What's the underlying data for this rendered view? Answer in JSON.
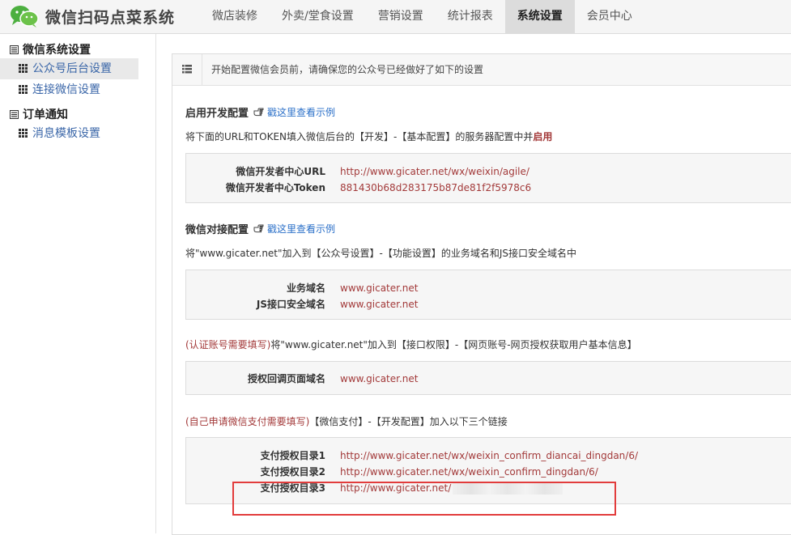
{
  "app": {
    "title": "微信扫码点菜系统"
  },
  "nav": [
    {
      "label": "微店装修"
    },
    {
      "label": "外卖/堂食设置"
    },
    {
      "label": "营销设置"
    },
    {
      "label": "统计报表"
    },
    {
      "label": "系统设置",
      "active": true
    },
    {
      "label": "会员中心"
    }
  ],
  "sidebar": {
    "groups": [
      {
        "title": "微信系统设置",
        "items": [
          {
            "label": "公众号后台设置",
            "active": true
          },
          {
            "label": "连接微信设置"
          }
        ]
      },
      {
        "title": "订单通知",
        "items": [
          {
            "label": "消息模板设置"
          }
        ]
      }
    ]
  },
  "content": {
    "header": "开始配置微信会员前，请确保您的公众号已经做好了如下的设置",
    "sections": [
      {
        "title": "启用开发配置",
        "link": "戳这里查看示例",
        "desc_pre": "将下面的URL和TOKEN填入微信后台的【开发】-【基本配置】的服务器配置中并",
        "desc_red": "启用",
        "rows": [
          {
            "label": "微信开发者中心URL",
            "value": "http://www.gicater.net/wx/weixin/agile/"
          },
          {
            "label": "微信开发者中心Token",
            "value": "881430b68d283175b87de81f2f5978c6"
          }
        ]
      },
      {
        "title": "微信对接配置",
        "link": "戳这里查看示例",
        "desc": "将\"www.gicater.net\"加入到【公众号设置】-【功能设置】的业务域名和JS接口安全域名中",
        "rows": [
          {
            "label": "业务域名",
            "value": "www.gicater.net"
          },
          {
            "label": "JS接口安全域名",
            "value": "www.gicater.net"
          }
        ]
      },
      {
        "desc_red": "(认证账号需要填写)",
        "desc": "将\"www.gicater.net\"加入到【接口权限】-【网页账号-网页授权获取用户基本信息】",
        "rows": [
          {
            "label": "授权回调页面域名",
            "value": "www.gicater.net"
          }
        ]
      },
      {
        "desc_red": "(自己申请微信支付需要填写)",
        "desc": "【微信支付】-【开发配置】加入以下三个链接",
        "rows": [
          {
            "label": "支付授权目录1",
            "value": "http://www.gicater.net/wx/weixin_confirm_diancai_dingdan/6/"
          },
          {
            "label": "支付授权目录2",
            "value": "http://www.gicater.net/wx/weixin_confirm_dingdan/6/"
          },
          {
            "label": "支付授权目录3",
            "value": "http://www.gicater.net/"
          }
        ]
      }
    ]
  },
  "colors": {
    "accent_red": "#a33a3a",
    "link_blue": "#2a6fc8",
    "highlight_box": "#e23c3c"
  },
  "icons": {
    "logo": "wechat-logo-icon",
    "hand": "pointing-hand-icon",
    "grid": "grid-icon",
    "list": "list-icon"
  }
}
